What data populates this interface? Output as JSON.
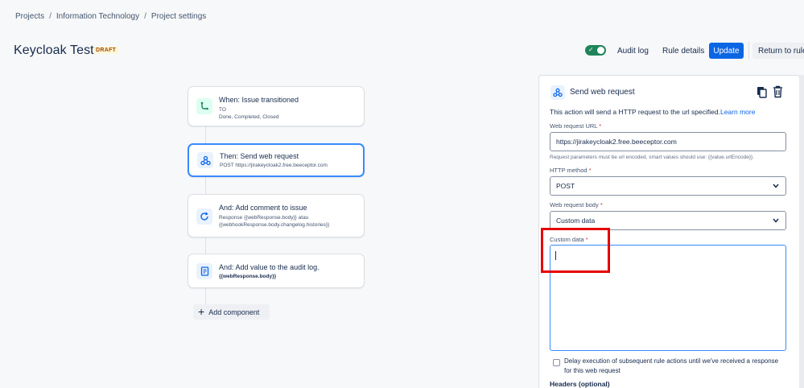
{
  "breadcrumb": {
    "items": [
      "Projects",
      "Information Technology",
      "Project settings"
    ],
    "separator": "/"
  },
  "header": {
    "title": "Keycloak Test",
    "status": "DRAFT",
    "audit_log": "Audit log",
    "rule_details": "Rule details",
    "update": "Update",
    "return": "Return to rules"
  },
  "rule": {
    "trigger": {
      "title": "When: Issue transitioned",
      "to_label": "TO",
      "to_values": "Done, Completed, Closed"
    },
    "action1": {
      "title": "Then: Send web request",
      "detail": "POST https://jirakeycloak2.free.beeceptor.com"
    },
    "action2": {
      "title": "And: Add comment to issue",
      "detail_line1": "Response {{webResponse.body}} atau",
      "detail_line2": "{{webhookResponse.body.changelog.histories}}"
    },
    "action3": {
      "title": "And: Add value to the audit log.",
      "detail": "{{webResponse.body}}"
    },
    "add_component": "Add component"
  },
  "panel": {
    "title": "Send web request",
    "description": "This action will send a HTTP request to the url specified.",
    "learn_more": "Learn more",
    "url_label": "Web request URL",
    "url_value": "https://jirakeycloak2.free.beeceptor.com",
    "url_hint": "Request parameters must be url encoded, smart values should use: {{value.urlEncode}}.",
    "method_label": "HTTP method",
    "method_value": "POST",
    "body_label": "Web request body",
    "body_value": "Custom data",
    "custom_label": "Custom data",
    "custom_value": "",
    "required_mark": "*",
    "delay_label": "Delay execution of subsequent rule actions until we've received a response for this web request",
    "headers_label": "Headers (optional)"
  },
  "colors": {
    "accent": "#0c66e4",
    "toggle_on": "#1f845a",
    "highlight": "#e60000",
    "focus": "#388bff"
  }
}
